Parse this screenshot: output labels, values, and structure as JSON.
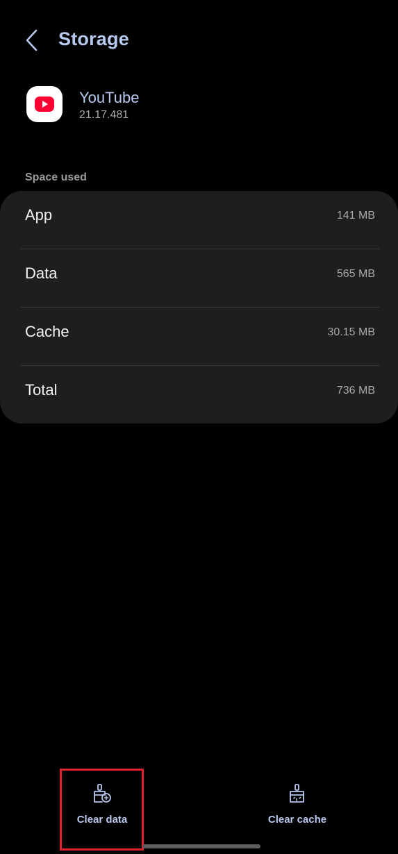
{
  "header": {
    "title": "Storage",
    "back_icon": "chevron-left-icon"
  },
  "app": {
    "name": "YouTube",
    "version": "21.17.481",
    "icon": "youtube-icon",
    "icon_color": "#ff0033"
  },
  "space_used": {
    "label": "Space used",
    "rows": [
      {
        "label": "App",
        "value": "141 MB"
      },
      {
        "label": "Data",
        "value": "565 MB"
      },
      {
        "label": "Cache",
        "value": "30.15 MB"
      },
      {
        "label": "Total",
        "value": "736 MB"
      }
    ]
  },
  "actions": {
    "clear_data": {
      "label": "Clear data",
      "icon": "broom-clear-data-icon"
    },
    "clear_cache": {
      "label": "Clear cache",
      "icon": "broom-clear-cache-icon"
    }
  },
  "colors": {
    "accent": "#b8c9ef",
    "background": "#000000",
    "card": "#1e1e1e",
    "highlight": "#e3212a"
  }
}
